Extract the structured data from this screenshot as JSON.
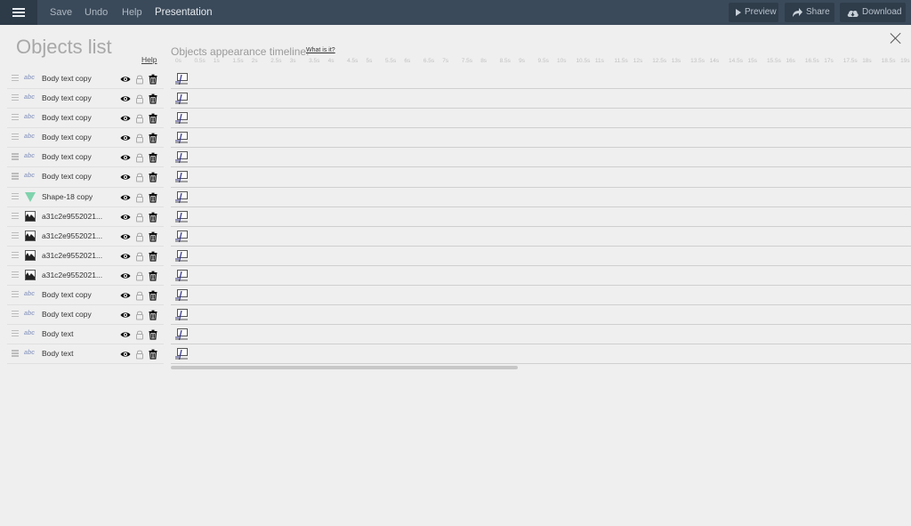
{
  "topbar": {
    "save": "Save",
    "undo": "Undo",
    "help": "Help",
    "title": "Presentation",
    "preview": "Preview",
    "share": "Share",
    "download": "Download"
  },
  "objects_panel": {
    "title": "Objects list",
    "help": "Help"
  },
  "timeline": {
    "title": "Objects appearance timeline.",
    "what_is_it": "What is it?",
    "ticks": [
      "0s",
      "0.5s",
      "1s",
      "1.5s",
      "2s",
      "2.5s",
      "3s",
      "3.5s",
      "4s",
      "4.5s",
      "5s",
      "5.5s",
      "6s",
      "6.5s",
      "7s",
      "7.5s",
      "8s",
      "8.5s",
      "9s",
      "9.5s",
      "10s",
      "10.5s",
      "11s",
      "11.5s",
      "12s",
      "12.5s",
      "13s",
      "13.5s",
      "14s",
      "14.5s",
      "15s",
      "15.5s",
      "16s",
      "16.5s",
      "17s",
      "17.5s",
      "18s",
      "18.5s",
      "19s"
    ]
  },
  "objects": [
    {
      "type": "text",
      "name": "Body text copy"
    },
    {
      "type": "text",
      "name": "Body text copy"
    },
    {
      "type": "text",
      "name": "Body text copy"
    },
    {
      "type": "text",
      "name": "Body text copy"
    },
    {
      "type": "text",
      "name": "Body text copy"
    },
    {
      "type": "text",
      "name": "Body text copy"
    },
    {
      "type": "shape",
      "name": "Shape-18 copy"
    },
    {
      "type": "image",
      "name": "a31c2e9552021..."
    },
    {
      "type": "image",
      "name": "a31c2e9552021..."
    },
    {
      "type": "image",
      "name": "a31c2e9552021..."
    },
    {
      "type": "image",
      "name": "a31c2e9552021..."
    },
    {
      "type": "text",
      "name": "Body text copy"
    },
    {
      "type": "text",
      "name": "Body text copy"
    },
    {
      "type": "text",
      "name": "Body text"
    },
    {
      "type": "text",
      "name": "Body text"
    }
  ],
  "text_type_glyph": "abc",
  "colors": {
    "topbar": "#3b4a5a",
    "shape_icon": "#7fd3ad",
    "text_icon": "#9aa6c8"
  }
}
